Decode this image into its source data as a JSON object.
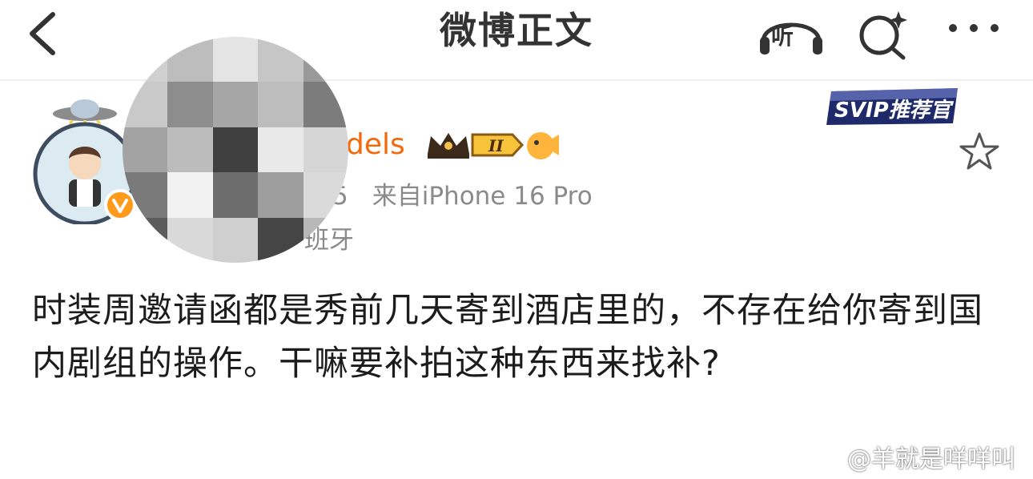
{
  "header": {
    "title": "微博正文",
    "listen_label": "听"
  },
  "author": {
    "name_visible": "dels",
    "level_badge": "II",
    "meta_time_fragment": "5",
    "meta_source": "来自iPhone 16 Pro",
    "location_fragment": "班牙"
  },
  "badges": {
    "svip_label": "SVIP推荐官"
  },
  "post": {
    "text": "时装周邀请函都是秀前几天寄到酒店里的，不存在给你寄到国内剧组的操作。干嘛要补拍这种东西来找补?"
  },
  "watermark": {
    "text": "@羊就是咩咩叫"
  },
  "colors": {
    "accent_orange": "#f26a0c",
    "meta_gray": "#8a8a8a",
    "svip_navy": "#1f2a6b"
  },
  "icons": [
    "back-arrow-icon",
    "headphones-icon",
    "search-sparkle-icon",
    "more-dots-icon",
    "verified-icon",
    "crown-icon",
    "emoji-fish-icon",
    "star-icon",
    "weibo-logo-icon"
  ]
}
